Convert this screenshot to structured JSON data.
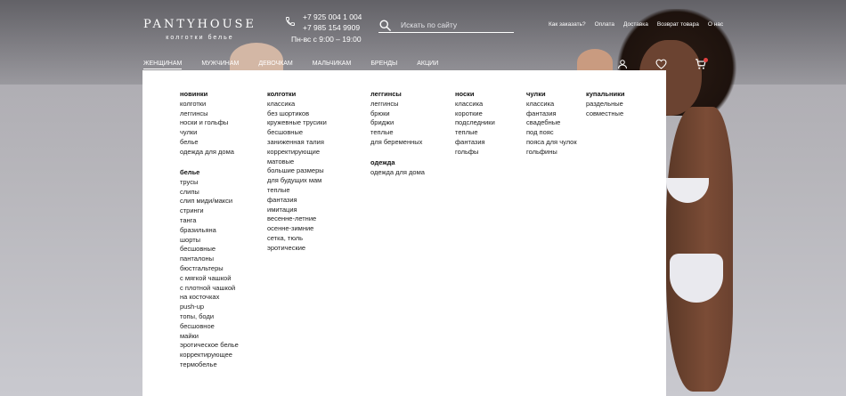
{
  "brand": {
    "name": "PANTYHOUSE",
    "tagline": "колготки белье"
  },
  "contacts": {
    "phones": [
      "+7 925 004 1 004",
      "+7 985 154 9909"
    ],
    "hours": "Пн-вс с 9:00 – 19:00"
  },
  "search": {
    "placeholder": "Искать по сайту"
  },
  "top_links": [
    "Как заказать?",
    "Оплата",
    "Доставка",
    "Возврат товара",
    "О нас"
  ],
  "nav": [
    "ЖЕНЩИНАМ",
    "МУЖЧИНАМ",
    "ДЕВОЧКАМ",
    "МАЛЬЧИКАМ",
    "БРЕНДЫ",
    "АКЦИИ"
  ],
  "nav_active": "ЖЕНЩИНАМ",
  "icons": {
    "phone": "phone-icon",
    "search": "search-icon",
    "user": "user-icon",
    "wishlist": "heart-icon",
    "cart": "cart-icon"
  },
  "colors": {
    "header_text": "#ffffff",
    "menu_bg": "#ffffff",
    "cart_badge": "#e04040"
  },
  "menu": {
    "col1": [
      {
        "title": "новинки",
        "items": [
          "колготки",
          "леггинсы",
          "носки и гольфы",
          "чулки",
          "белье",
          "одежда для дома"
        ]
      },
      {
        "title": "белье",
        "items": [
          "трусы",
          "слипы",
          "слип миди/макси",
          "стринги",
          "танга",
          "бразильяна",
          "шорты",
          "бесшовные",
          "панталоны",
          "бюстгальтеры",
          "с мягкой чашкой",
          "с плотной чашкой",
          "на косточках",
          "push-up",
          "топы, боди",
          "бесшовное",
          "майки",
          "эротическое белье",
          "корректирующее",
          "термобелье"
        ]
      }
    ],
    "col2": [
      {
        "title": "колготки",
        "items": [
          "классика",
          "без шортиков",
          "кружевные трусики",
          "бесшовные",
          "заниженная талия",
          "корректирующие",
          "матовые",
          "большие размеры",
          "для будущих мам",
          "теплые",
          "фантазия",
          "имитация",
          "весенне-летние",
          "осенне-зимние",
          "сетка, тюль",
          "эротические"
        ]
      }
    ],
    "col3": [
      {
        "title": "леггинсы",
        "items": [
          "леггинсы",
          "брюки",
          "бриджи",
          "теплые",
          "для беременных"
        ]
      },
      {
        "title": "одежда",
        "items": [
          "одежда для дома"
        ]
      }
    ],
    "col4": [
      {
        "title": "носки",
        "items": [
          "классика",
          "короткие",
          "подследники",
          "теплые",
          "фантазия",
          "гольфы"
        ]
      }
    ],
    "col5": [
      {
        "title": "чулки",
        "items": [
          "классика",
          "фантазия",
          "свадебные",
          "под пояс",
          "пояса для чулок",
          "гольфины"
        ]
      }
    ],
    "col6": [
      {
        "title": "купальники",
        "items": [
          "раздельные",
          "совместные"
        ]
      }
    ]
  }
}
